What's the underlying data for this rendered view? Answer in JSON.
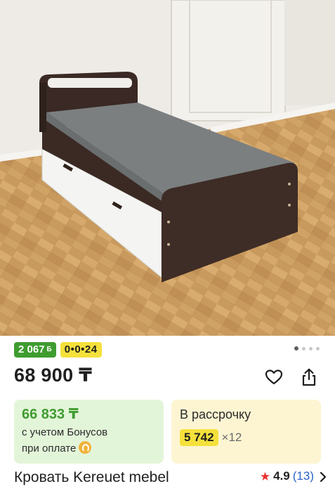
{
  "product": {
    "image_alt": "bed-photo",
    "price": "68 900 ₸",
    "title": "Кровать Kereuet mebel",
    "rating": "4.9",
    "reviews": "(13)"
  },
  "badges": {
    "bonus": "2 067",
    "bonus_currency": "Б",
    "installment_plan": "0•0•24"
  },
  "gallery": {
    "pages": 4,
    "active_index": 0
  },
  "bonus_card": {
    "price": "66 833 ₸",
    "note_line1": "с учетом Бонусов",
    "note_line2": "при оплате"
  },
  "installment_card": {
    "title": "В рассрочку",
    "amount": "5 742",
    "multiplier": "×12"
  },
  "colors": {
    "accent_green": "#3f9c2f",
    "accent_yellow": "#f5e13b",
    "bonus_bg": "#e3f5d9",
    "install_bg": "#fdf5d2",
    "rating_star": "#e8312f",
    "link_blue": "#2a64c9"
  },
  "icons": [
    "heart-icon",
    "share-icon",
    "star-icon",
    "chevron-right-icon",
    "bonus-coin-icon"
  ]
}
